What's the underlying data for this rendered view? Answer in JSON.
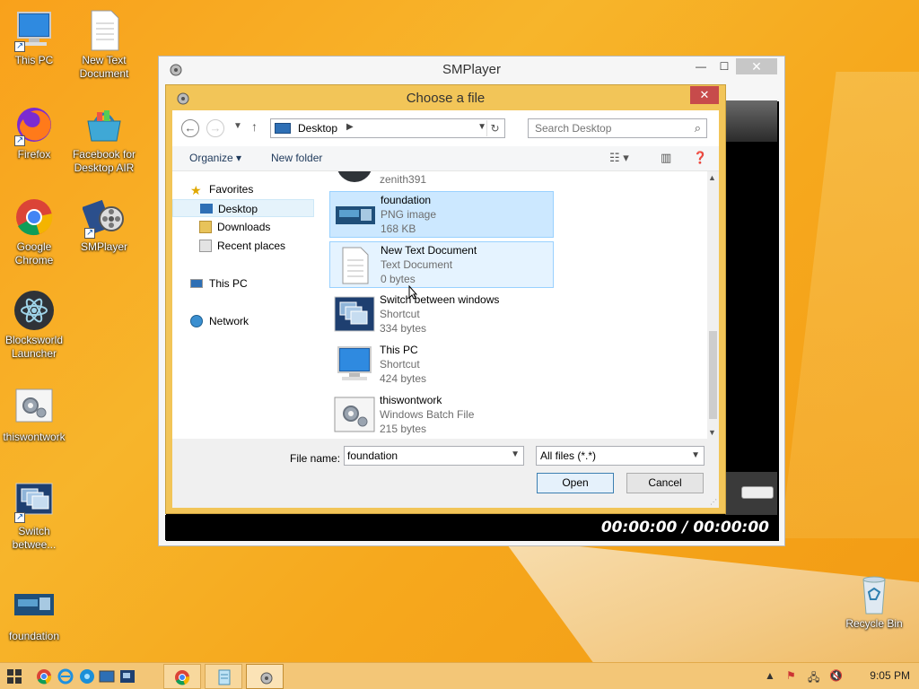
{
  "desktop": {
    "icons": [
      {
        "label": "This PC"
      },
      {
        "label": "New Text Document"
      },
      {
        "label": "Firefox"
      },
      {
        "label": "Facebook for Desktop AIR"
      },
      {
        "label": "Google Chrome"
      },
      {
        "label": "SMPlayer"
      },
      {
        "label": "Blocksworld Launcher"
      },
      {
        "label": "thiswontwork"
      },
      {
        "label": "Switch betwee..."
      },
      {
        "label": "foundation"
      },
      {
        "label": "Recycle Bin"
      }
    ]
  },
  "smplayer": {
    "title": "SMPlayer",
    "minimize": "—",
    "maximize": "☐",
    "close": "✕",
    "time_display": "00:00:00 / 00:00:00"
  },
  "dialog": {
    "title": "Choose a file",
    "close": "✕",
    "address": {
      "location": "Desktop"
    },
    "search": {
      "placeholder": "Search Desktop"
    },
    "toolbar": {
      "organize": "Organize",
      "new_folder": "New folder"
    },
    "nav": {
      "favorites": "Favorites",
      "desktop": "Desktop",
      "downloads": "Downloads",
      "recent_places": "Recent places",
      "this_pc": "This PC",
      "network": "Network"
    },
    "files": [
      {
        "name": "zenith391",
        "type": "",
        "size": ""
      },
      {
        "name": "foundation",
        "type": "PNG image",
        "size": "168 KB"
      },
      {
        "name": "New Text Document",
        "type": "Text Document",
        "size": "0 bytes"
      },
      {
        "name": "Switch between windows",
        "type": "Shortcut",
        "size": "334 bytes"
      },
      {
        "name": "This PC",
        "type": "Shortcut",
        "size": "424 bytes"
      },
      {
        "name": "thiswontwork",
        "type": "Windows Batch File",
        "size": "215 bytes"
      }
    ],
    "file_name_label": "File name:",
    "file_name_value": "foundation",
    "file_type_selected": "All files (*.*)",
    "open_label": "Open",
    "cancel_label": "Cancel"
  },
  "taskbar": {
    "clock": "9:05 PM"
  }
}
